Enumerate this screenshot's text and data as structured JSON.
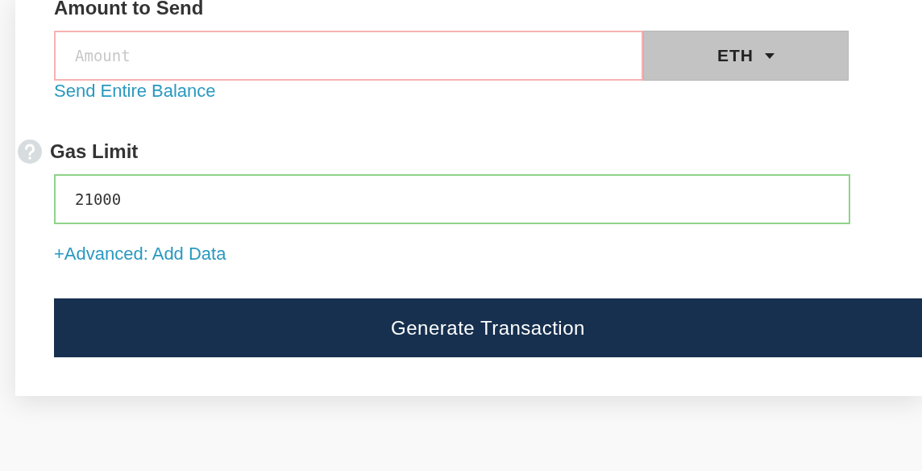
{
  "amount": {
    "label": "Amount to Send",
    "placeholder": "Amount",
    "error": true,
    "currency": "ETH",
    "link": "Send Entire Balance"
  },
  "gas": {
    "label": "Gas Limit",
    "help": true,
    "value": "21000",
    "error": false
  },
  "advanced_link": "+Advanced: Add Data",
  "submit_button": "Generate Transaction"
}
